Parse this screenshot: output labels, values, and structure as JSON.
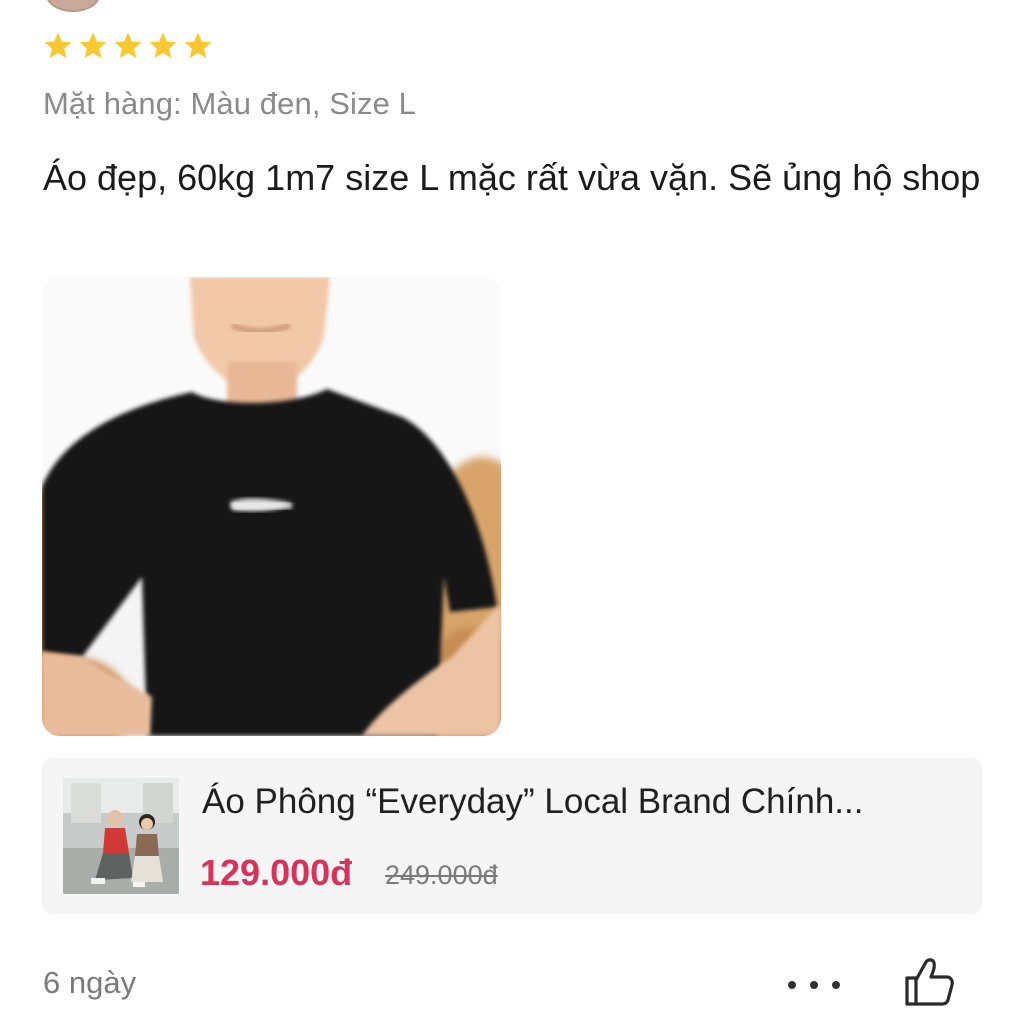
{
  "review": {
    "rating": 5,
    "rating_max": 5,
    "star_color": "#f8c830",
    "variant": "Mặt hàng: Màu đen, Size L",
    "text": "Áo đẹp, 60kg 1m7 size L mặc rất vừa vặn. Sẽ ủng hộ shop",
    "photo_icon": "review-photo-black-tshirt",
    "time": "6 ngày"
  },
  "product": {
    "title": "Áo Phông “Everyday” Local Brand Chính...",
    "price": "129.000đ",
    "old_price": "249.000đ",
    "price_color": "#d8325a"
  },
  "actions": {
    "more_icon": "more-horizontal-icon",
    "like_icon": "thumbs-up-icon"
  }
}
